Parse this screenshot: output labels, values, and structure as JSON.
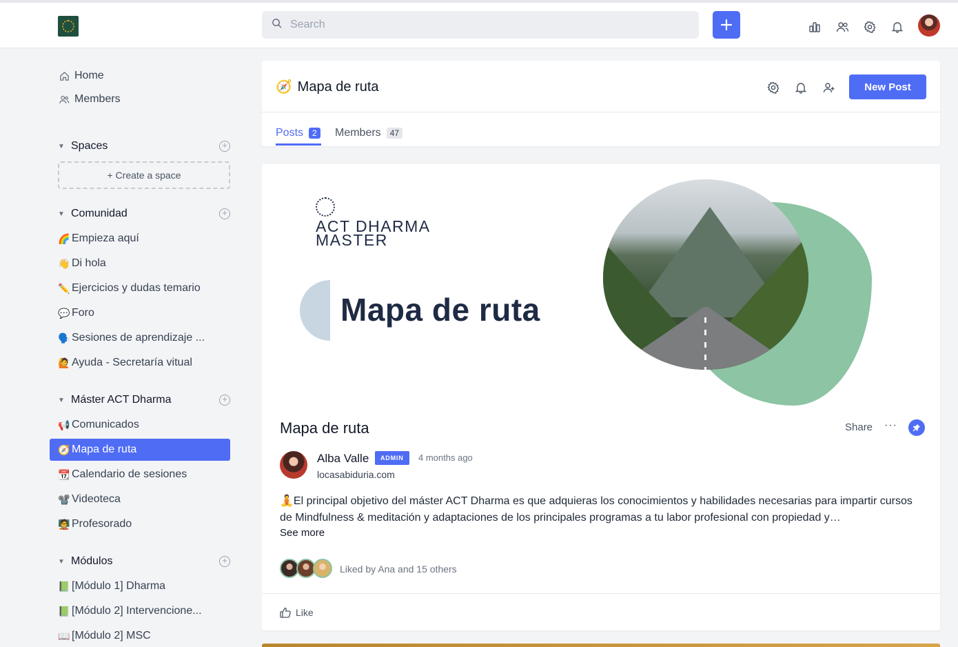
{
  "topbar": {
    "search_placeholder": "Search",
    "icons": [
      "chart-icon",
      "members-icon",
      "settings-icon",
      "bell-icon"
    ]
  },
  "sidebar": {
    "nav": [
      {
        "label": "Home",
        "icon": "home-icon"
      },
      {
        "label": "Members",
        "icon": "users-icon"
      }
    ],
    "spaces_heading": "Spaces",
    "create_space": "+ Create a space",
    "groups": [
      {
        "title": "Comunidad",
        "items": [
          {
            "emoji": "🌈",
            "label": "Empieza aquí"
          },
          {
            "emoji": "👋",
            "label": "Di hola"
          },
          {
            "emoji": "✏️",
            "label": "Ejercicios y dudas temario"
          },
          {
            "emoji": "💬",
            "label": "Foro"
          },
          {
            "emoji": "🗣️",
            "label": "Sesiones de aprendizaje ..."
          },
          {
            "emoji": "🙋",
            "label": "Ayuda - Secretaría vitual"
          }
        ]
      },
      {
        "title": "Máster ACT Dharma",
        "items": [
          {
            "emoji": "📢",
            "label": "Comunicados"
          },
          {
            "emoji": "🧭",
            "label": "Mapa de ruta",
            "active": true
          },
          {
            "emoji": "📆",
            "label": "Calendario de sesiones"
          },
          {
            "emoji": "📽️",
            "label": "Videoteca"
          },
          {
            "emoji": "🧑‍🏫",
            "label": "Profesorado"
          }
        ]
      },
      {
        "title": "Módulos",
        "items": [
          {
            "emoji": "📗",
            "label": "[Módulo 1] Dharma"
          },
          {
            "emoji": "📗",
            "label": "[Módulo 2] Intervencione..."
          },
          {
            "emoji": "📖",
            "label": "[Módulo 2] MSC"
          }
        ]
      }
    ]
  },
  "space_header": {
    "emoji": "🧭",
    "title": "Mapa de ruta",
    "new_post_label": "New Post",
    "tabs": [
      {
        "label": "Posts",
        "count": "2",
        "active": true
      },
      {
        "label": "Members",
        "count": "47"
      }
    ]
  },
  "post": {
    "banner": {
      "brand_line1": "ACT DHARMA",
      "brand_line2": "MASTER",
      "brand_ring_text": "LOCASABIDURIA",
      "big_title": "Mapa de ruta"
    },
    "title": "Mapa de ruta",
    "share_label": "Share",
    "more_label": "···",
    "author": {
      "name": "Alba Valle",
      "badge": "ADMIN",
      "time": "4 months ago",
      "subtitle": "locasabiduria.com"
    },
    "body": "🧘El principal objetivo del máster ACT Dharma es que adquieras los conocimientos y habilidades necesarias para impartir cursos de Mindfulness & meditación y adaptaciones de los principales programas a tu labor profesional con propiedad y…",
    "see_more": "See more",
    "liked_text": "Liked by Ana and 15 others",
    "like_label": "Like"
  }
}
